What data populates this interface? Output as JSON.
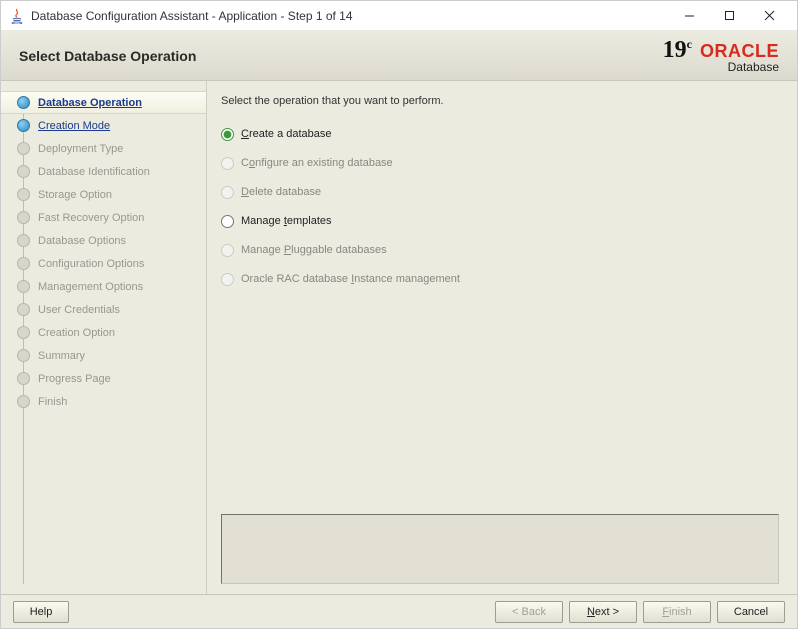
{
  "titlebar": {
    "title": "Database Configuration Assistant - Application - Step 1 of 14"
  },
  "header": {
    "title": "Select Database Operation",
    "version": "19",
    "version_suffix": "c",
    "brand": "ORACLE",
    "brand_sub": "Database"
  },
  "sidebar": {
    "steps": [
      {
        "label": "Database Operation",
        "state": "active"
      },
      {
        "label": "Creation Mode",
        "state": "link"
      },
      {
        "label": "Deployment Type",
        "state": "disabled"
      },
      {
        "label": "Database Identification",
        "state": "disabled"
      },
      {
        "label": "Storage Option",
        "state": "disabled"
      },
      {
        "label": "Fast Recovery Option",
        "state": "disabled"
      },
      {
        "label": "Database Options",
        "state": "disabled"
      },
      {
        "label": "Configuration Options",
        "state": "disabled"
      },
      {
        "label": "Management Options",
        "state": "disabled"
      },
      {
        "label": "User Credentials",
        "state": "disabled"
      },
      {
        "label": "Creation Option",
        "state": "disabled"
      },
      {
        "label": "Summary",
        "state": "disabled"
      },
      {
        "label": "Progress Page",
        "state": "disabled"
      },
      {
        "label": "Finish",
        "state": "disabled"
      }
    ]
  },
  "main": {
    "instruction": "Select the operation that you want to perform.",
    "options": [
      {
        "label": "Create a database",
        "mnemonic": "C",
        "enabled": true,
        "selected": true
      },
      {
        "label": "Configure an existing database",
        "mnemonic": "o",
        "enabled": false,
        "selected": false
      },
      {
        "label": "Delete database",
        "mnemonic": "D",
        "enabled": false,
        "selected": false
      },
      {
        "label": "Manage templates",
        "mnemonic": "t",
        "enabled": true,
        "selected": false
      },
      {
        "label": "Manage Pluggable databases",
        "mnemonic": "P",
        "enabled": false,
        "selected": false
      },
      {
        "label": "Oracle RAC database Instance management",
        "mnemonic": "I",
        "enabled": false,
        "selected": false
      }
    ]
  },
  "footer": {
    "help": "Help",
    "back": "< Back",
    "next": "Next >",
    "finish": "Finish",
    "cancel": "Cancel"
  }
}
